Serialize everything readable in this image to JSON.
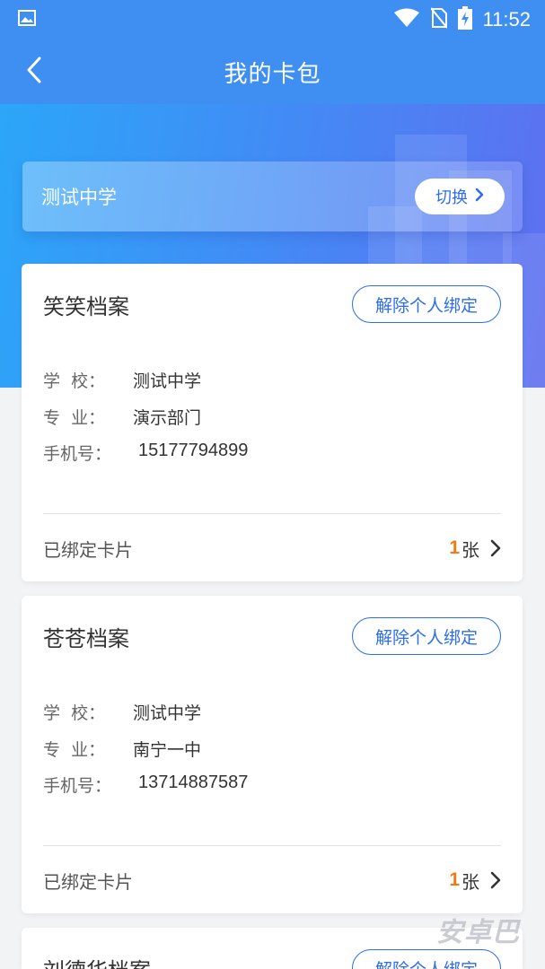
{
  "status_bar": {
    "time": "11:52",
    "icons": [
      "image-icon",
      "wifi-icon",
      "no-sim-icon",
      "battery-charging-icon"
    ]
  },
  "header": {
    "title": "我的卡包",
    "back_icon": "back-arrow-icon"
  },
  "school": {
    "name": "测试中学",
    "switch_label": "切换"
  },
  "cards": [
    {
      "title": "笑笑档案",
      "unbind_label": "解除个人绑定",
      "school_label": "学  校：",
      "school_value": "测试中学",
      "major_label": "专  业：",
      "major_value": "演示部门",
      "phone_label": "手机号：",
      "phone_value": "15177794899",
      "bound_label": "已绑定卡片",
      "bound_count": "1",
      "bound_unit": "张"
    },
    {
      "title": "苍苍档案",
      "unbind_label": "解除个人绑定",
      "school_label": "学  校：",
      "school_value": "测试中学",
      "major_label": "专  业：",
      "major_value": "南宁一中",
      "phone_label": "手机号：",
      "phone_value": "13714887587",
      "bound_label": "已绑定卡片",
      "bound_count": "1",
      "bound_unit": "张"
    },
    {
      "title": "刘德华档案",
      "unbind_label": "解除个人绑定"
    }
  ],
  "watermark": "安卓巴",
  "colors": {
    "primary": "#2c6cf0",
    "header_bg": "#3f8ff2",
    "accent_count": "#f07a16",
    "page_bg": "#f2f3f5"
  }
}
